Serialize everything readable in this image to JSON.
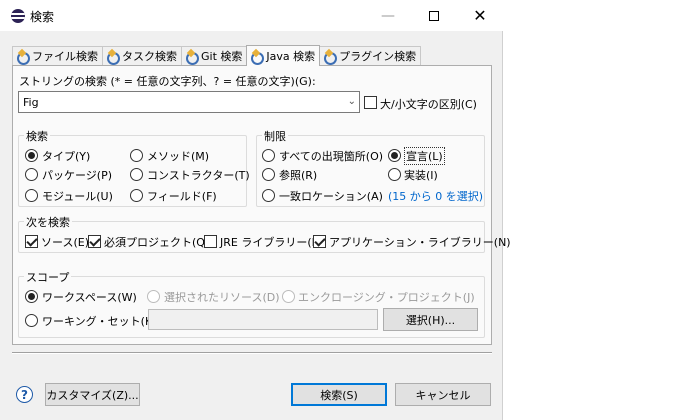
{
  "window": {
    "title": "検索",
    "minimize": "—",
    "close": "✕"
  },
  "tabs": [
    {
      "label": "ファイル検索"
    },
    {
      "label": "タスク検索"
    },
    {
      "label": "Git 検索"
    },
    {
      "label": "Java 検索"
    },
    {
      "label": "プラグイン検索"
    }
  ],
  "search_string": {
    "label": "ストリングの検索 (* = 任意の文字列、? = 任意の文字)(G):",
    "value": "Fig",
    "case_sensitive_label": "大/小文字の区別(C)"
  },
  "search_for": {
    "title": "検索",
    "options": [
      "タイプ(Y)",
      "メソッド(M)",
      "パッケージ(P)",
      "コンストラクター(T)",
      "モジュール(U)",
      "フィールド(F)"
    ]
  },
  "limit_to": {
    "title": "制限",
    "options": [
      "すべての出現箇所(O)",
      "宣言(L)",
      "参照(R)",
      "実装(I)",
      "一致ロケーション(A)"
    ],
    "select_link": "(15 から 0 を選択)"
  },
  "search_in": {
    "title": "次を検索",
    "options": [
      "ソース(E)",
      "必須プロジェクト(Q)",
      "JRE ライブラリー(B)",
      "アプリケーション・ライブラリー(N)"
    ]
  },
  "scope": {
    "title": "スコープ",
    "workspace": "ワークスペース(W)",
    "selected": "選択されたリソース(D)",
    "enclosing": "エンクロージング・プロジェクト(J)",
    "working_set": "ワーキング・セット(K):",
    "working_set_value": "",
    "choose_button": "選択(H)..."
  },
  "footer": {
    "help": "?",
    "customize": "カスタマイズ(Z)...",
    "search": "検索(S)",
    "cancel": "キャンセル"
  }
}
